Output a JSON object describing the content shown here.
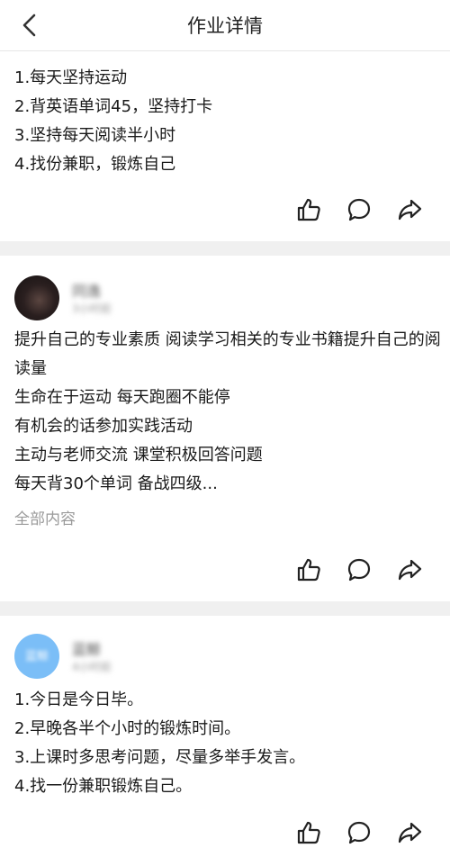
{
  "header": {
    "title": "作业详情"
  },
  "posts": [
    {
      "lines": [
        "1.每天坚持运动",
        "2.背英语单词45，坚持打卡",
        "3.坚持每天阅读半小时",
        "4.找份兼职，锻炼自己"
      ]
    },
    {
      "user": {
        "name": "同逸",
        "time": "3小时前"
      },
      "lines": [
        "提升自己的专业素质 阅读学习相关的专业书籍提升自己的阅读量",
        "生命在于运动 每天跑圈不能停",
        "有机会的话参加实践活动",
        "主动与老师交流 课堂积极回答问题",
        "每天背30个单词 备战四级..."
      ],
      "more_label": "全部内容"
    },
    {
      "user": {
        "name": "蓝鲸",
        "time": "4小时前",
        "avatar_text": "蓝鲸"
      },
      "lines": [
        "1.今日是今日毕。",
        "2.早晚各半个小时的锻炼时间。",
        "3.上课时多思考问题，尽量多举手发言。",
        "4.找一份兼职锻炼自己。"
      ]
    }
  ],
  "icons": {
    "back": "chevron-left-icon",
    "like": "thumbs-up-icon",
    "comment": "comment-bubble-icon",
    "share": "share-arrow-icon"
  },
  "colors": {
    "separator": "#f0f0f0",
    "muted_text": "#9a9a9a",
    "avatar_blue": "#7bbef7"
  }
}
